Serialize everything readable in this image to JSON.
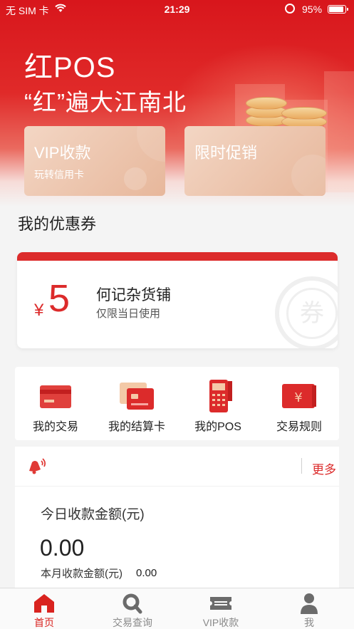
{
  "status_bar": {
    "carrier": "无 SIM 卡",
    "time": "21:29",
    "battery": "95%"
  },
  "hero": {
    "brand": "红POS",
    "slogan": "“红”遍大江南北"
  },
  "promos": [
    {
      "title": "VIP收款",
      "subtitle": "玩转信用卡"
    },
    {
      "title": "限时促销",
      "subtitle": ""
    }
  ],
  "coupons": {
    "section_title": "我的优惠券",
    "currency": "¥",
    "amount": "5",
    "shop": "何记杂货铺",
    "note": "仅限当日使用",
    "stamp": "券"
  },
  "quick_menu": [
    {
      "label": "我的交易",
      "icon": "card-icon"
    },
    {
      "label": "我的结算卡",
      "icon": "settlement-card-icon"
    },
    {
      "label": "我的POS",
      "icon": "pos-terminal-icon"
    },
    {
      "label": "交易规则",
      "icon": "yen-card-icon"
    }
  ],
  "stats": {
    "more": "更多",
    "today_label": "今日收款金额(元)",
    "today_value": "0.00",
    "month_label": "本月收款金额(元)",
    "month_value": "0.00"
  },
  "tabs": [
    {
      "label": "首页",
      "icon": "home-icon",
      "active": true
    },
    {
      "label": "交易查询",
      "icon": "search-icon",
      "active": false
    },
    {
      "label": "VIP收款",
      "icon": "ticket-icon",
      "active": false
    },
    {
      "label": "我",
      "icon": "user-icon",
      "active": false
    }
  ],
  "colors": {
    "brand_red": "#dc2b2b",
    "promo_gold": "#e7b79b",
    "tab_inactive": "#8a8a8a"
  }
}
